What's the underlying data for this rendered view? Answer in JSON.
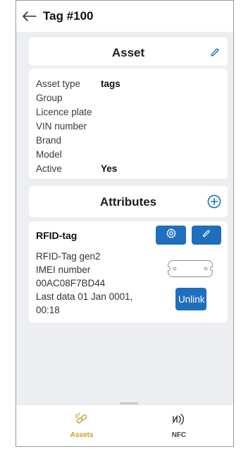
{
  "header": {
    "title": "Tag #100"
  },
  "asset": {
    "title": "Asset",
    "fields": [
      {
        "label": "Asset type",
        "value": "tags"
      },
      {
        "label": "Group",
        "value": ""
      },
      {
        "label": "Licence plate",
        "value": ""
      },
      {
        "label": "VIN number",
        "value": ""
      },
      {
        "label": "Brand",
        "value": ""
      },
      {
        "label": "Model",
        "value": ""
      },
      {
        "label": "Active",
        "value": "Yes"
      }
    ]
  },
  "attributes": {
    "title": "Attributes",
    "tag": {
      "name": "RFID-tag",
      "model": "RFID-Tag gen2",
      "imei_label": "IMEI number",
      "imei": "00AC08F7BD44",
      "last_data_line1": "Last data 01 Jan 0001,",
      "last_data_line2": "00:18",
      "unlink_label": "Unlink"
    }
  },
  "nav": {
    "items": [
      {
        "label": "Assets",
        "icon": "link-icon",
        "active": true
      },
      {
        "label": "NFC",
        "icon": "nfc-icon",
        "active": false
      }
    ]
  },
  "colors": {
    "accent": "#1f6fbf",
    "nav_active": "#d29a26",
    "background": "#eceef1"
  }
}
